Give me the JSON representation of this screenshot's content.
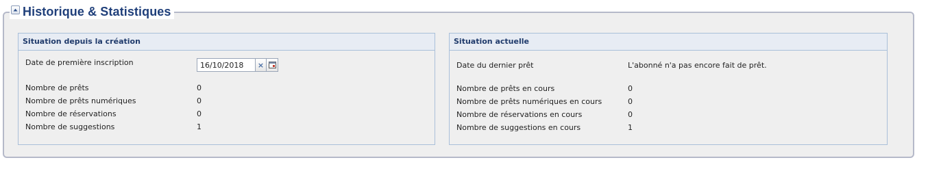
{
  "section": {
    "title": "Historique & Statistiques"
  },
  "left_panel": {
    "header": "Situation depuis la création",
    "first_registration": {
      "label": "Date de première inscription",
      "value": "16/10/2018",
      "clear_symbol": "×"
    },
    "rows": [
      {
        "label": "Nombre de prêts",
        "value": "0"
      },
      {
        "label": "Nombre de prêts numériques",
        "value": "0"
      },
      {
        "label": "Nombre de réservations",
        "value": "0"
      },
      {
        "label": "Nombre de suggestions",
        "value": "1"
      }
    ]
  },
  "right_panel": {
    "header": "Situation actuelle",
    "last_loan": {
      "label": "Date du dernier prêt",
      "value": "L'abonné n'a pas encore fait de prêt."
    },
    "rows": [
      {
        "label": "Nombre de prêts en cours",
        "value": "0"
      },
      {
        "label": "Nombre de prêts numériques en cours",
        "value": "0"
      },
      {
        "label": "Nombre de réservations en cours",
        "value": "0"
      },
      {
        "label": "Nombre de suggestions en cours",
        "value": "1"
      }
    ]
  },
  "icons": {
    "collapse": "collapse-up-icon",
    "clear": "clear-x-icon",
    "calendar": "calendar-icon"
  }
}
